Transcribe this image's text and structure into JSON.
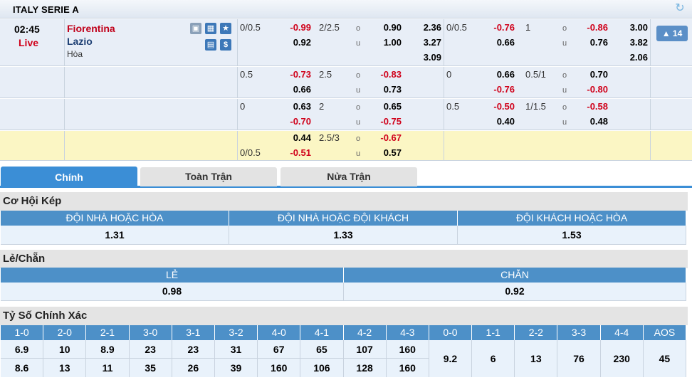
{
  "league": "ITALY SERIE A",
  "match": {
    "time": "02:45",
    "status": "Live",
    "home": "Fiorentina",
    "away": "Lazio",
    "draw": "Hòa",
    "more": "14"
  },
  "odds_rows": [
    {
      "c1": [
        "0/0.5",
        ""
      ],
      "c2": [
        "-0.99",
        "0.92"
      ],
      "c3": [
        "2/2.5",
        ""
      ],
      "c4": [
        "o",
        "u"
      ],
      "c5": [
        "0.90",
        "1.00"
      ],
      "c6": [
        "2.36",
        "3.27",
        "3.09"
      ],
      "c7": [
        "0/0.5",
        ""
      ],
      "c8": [
        "-0.76",
        "0.66"
      ],
      "c9": [
        "1",
        ""
      ],
      "c10": [
        "o",
        "u"
      ],
      "c11": [
        "-0.86",
        "0.76"
      ],
      "c12": [
        "3.00",
        "3.82",
        "2.06"
      ]
    },
    {
      "c1": [
        "0.5",
        ""
      ],
      "c2": [
        "-0.73",
        "0.66"
      ],
      "c3": [
        "2.5",
        ""
      ],
      "c4": [
        "o",
        "u"
      ],
      "c5": [
        "-0.83",
        "0.73"
      ],
      "c7": [
        "0",
        ""
      ],
      "c8": [
        "0.66",
        "-0.76"
      ],
      "c9": [
        "0.5/1",
        ""
      ],
      "c10": [
        "o",
        "u"
      ],
      "c11": [
        "0.70",
        "-0.80"
      ]
    },
    {
      "c1": [
        "0",
        ""
      ],
      "c2": [
        "0.63",
        "-0.70"
      ],
      "c3": [
        "2",
        ""
      ],
      "c4": [
        "o",
        "u"
      ],
      "c5": [
        "0.65",
        "-0.75"
      ],
      "c7": [
        "0.5",
        ""
      ],
      "c8": [
        "-0.50",
        "0.40"
      ],
      "c9": [
        "1/1.5",
        ""
      ],
      "c10": [
        "o",
        "u"
      ],
      "c11": [
        "-0.58",
        "0.48"
      ]
    },
    {
      "c1": [
        "",
        "0/0.5"
      ],
      "c2": [
        "0.44",
        "-0.51"
      ],
      "c3": [
        "2.5/3",
        ""
      ],
      "c4": [
        "o",
        "u"
      ],
      "c5": [
        "-0.67",
        "0.57"
      ]
    }
  ],
  "tabs": [
    {
      "label": "Chính"
    },
    {
      "label": "Toàn Trận"
    },
    {
      "label": "Nửa Trận"
    }
  ],
  "double_chance": {
    "title": "Cơ Hội Kép",
    "headers": [
      "ĐỘI NHÀ HOẶC HÒA",
      "ĐỘI NHÀ HOẶC ĐỘI KHÁCH",
      "ĐỘI KHÁCH HOẶC HÒA"
    ],
    "values": [
      "1.31",
      "1.33",
      "1.53"
    ]
  },
  "odd_even": {
    "title": "Lẻ/Chẵn",
    "headers": [
      "LẺ",
      "CHẴN"
    ],
    "values": [
      "0.98",
      "0.92"
    ]
  },
  "correct_score": {
    "title": "Tỷ Số Chính Xác",
    "headers": [
      "1-0",
      "2-0",
      "2-1",
      "3-0",
      "3-1",
      "3-2",
      "4-0",
      "4-1",
      "4-2",
      "4-3",
      "0-0",
      "1-1",
      "2-2",
      "3-3",
      "4-4",
      "AOS"
    ],
    "home_values": [
      "6.9",
      "10",
      "8.9",
      "23",
      "23",
      "31",
      "67",
      "65",
      "107",
      "160"
    ],
    "away_values": [
      "8.6",
      "13",
      "11",
      "35",
      "26",
      "39",
      "160",
      "106",
      "128",
      "160"
    ],
    "draw_values": [
      "9.2",
      "6",
      "13",
      "76",
      "230",
      "45"
    ]
  },
  "colors": {
    "negative": "#d0021b",
    "tab_active": "#3b8ed6",
    "header_blue": "#4d90c8",
    "row_yellow": "#fbf6c4"
  }
}
